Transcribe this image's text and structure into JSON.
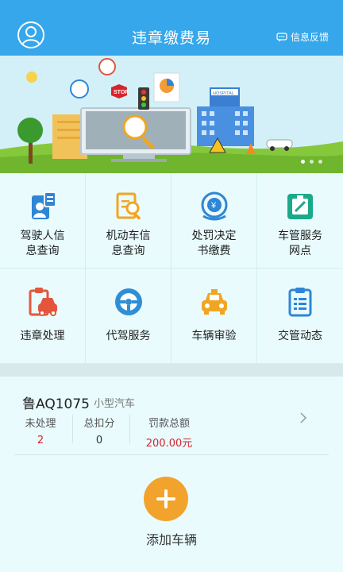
{
  "header": {
    "title": "违章缴费易",
    "feedback_label": "信息反馈",
    "avatar_icon": "user-avatar-icon",
    "background": "#35a7ea"
  },
  "banner": {
    "sign_texts": [
      "STOP",
      "HOSPITAL"
    ],
    "slide_count": 3,
    "active_slide": 1
  },
  "services": [
    {
      "label": "驾驶人信息查询",
      "line1": "驾驶人信",
      "line2": "息查询",
      "icon": "driver-license-icon",
      "color": "#2f86d6"
    },
    {
      "label": "机动车信息查询",
      "line1": "机动车信",
      "line2": "息查询",
      "icon": "vehicle-search-icon",
      "color": "#f0a623"
    },
    {
      "label": "处罚决定书缴费",
      "line1": "处罚决定",
      "line2": "书缴费",
      "icon": "payment-icon",
      "color": "#2f86d6"
    },
    {
      "label": "车管服务网点",
      "line1": "车管服务",
      "line2": "网点",
      "icon": "service-point-icon",
      "color": "#1aaa8a"
    },
    {
      "label": "违章处理",
      "line1": "违章处理",
      "line2": "",
      "icon": "violation-icon",
      "color": "#e4553c"
    },
    {
      "label": "代驾服务",
      "line1": "代驾服务",
      "line2": "",
      "icon": "steering-wheel-icon",
      "color": "#2f8fd6"
    },
    {
      "label": "车辆审验",
      "line1": "车辆审验",
      "line2": "",
      "icon": "car-inspection-icon",
      "color": "#f0a623"
    },
    {
      "label": "交管动态",
      "line1": "交管动态",
      "line2": "",
      "icon": "clipboard-icon",
      "color": "#2f86d6"
    }
  ],
  "vehicle": {
    "plate": "鲁AQ1075",
    "type": "小型汽车",
    "unprocessed_label": "未处理",
    "unprocessed_value": "2",
    "points_label": "总扣分",
    "points_value": "0",
    "fine_label": "罚款总额",
    "fine_value": "200.00元",
    "accent": "#d4262c"
  },
  "add_vehicle": {
    "label": "添加车辆",
    "color": "#f2a32c"
  }
}
